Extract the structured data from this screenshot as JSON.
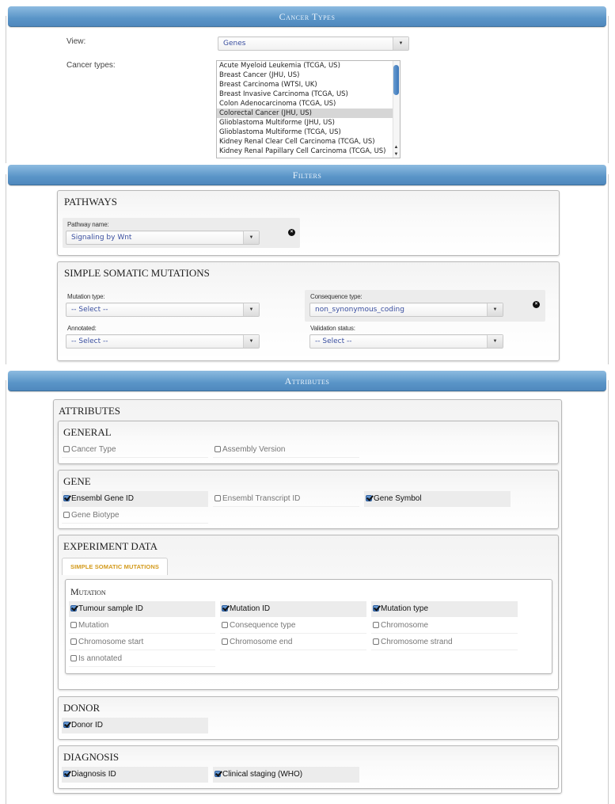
{
  "cancer_types_section": {
    "header": "Cancer Types",
    "view_label": "View:",
    "view_value": "Genes",
    "cancer_types_label": "Cancer types:",
    "cancer_types": [
      {
        "label": "Acute Myeloid Leukemia (TCGA, US)",
        "selected": false
      },
      {
        "label": "Breast Cancer (JHU, US)",
        "selected": false
      },
      {
        "label": "Breast Carcinoma (WTSI, UK)",
        "selected": false
      },
      {
        "label": "Breast Invasive Carcinoma (TCGA, US)",
        "selected": false
      },
      {
        "label": "Colon Adenocarcinoma (TCGA, US)",
        "selected": false
      },
      {
        "label": "Colorectal Cancer (JHU, US)",
        "selected": true
      },
      {
        "label": "Glioblastoma Multiforme (JHU, US)",
        "selected": false
      },
      {
        "label": "Glioblastoma Multiforme (TCGA, US)",
        "selected": false
      },
      {
        "label": "Kidney Renal Clear Cell Carcinoma (TCGA, US)",
        "selected": false
      },
      {
        "label": "Kidney Renal Papillary Cell Carcinoma (TCGA, US)",
        "selected": false
      }
    ]
  },
  "filters_section": {
    "header": "Filters",
    "pathways": {
      "title": "PATHWAYS",
      "pathway_name_label": "Pathway name:",
      "pathway_name_value": "Signaling by Wnt"
    },
    "ssm": {
      "title": "SIMPLE SOMATIC MUTATIONS",
      "mutation_type_label": "Mutation type:",
      "mutation_type_value": "-- Select --",
      "consequence_type_label": "Consequence type:",
      "consequence_type_value": "non_synonymous_coding",
      "annotated_label": "Annotated:",
      "annotated_value": "-- Select --",
      "validation_status_label": "Validation status:",
      "validation_status_value": "-- Select --"
    }
  },
  "attributes_section": {
    "header": "Attributes",
    "title": "ATTRIBUTES",
    "general": {
      "title": "GENERAL",
      "items": [
        {
          "label": "Cancer Type",
          "checked": false
        },
        {
          "label": "Assembly Version",
          "checked": false
        }
      ]
    },
    "gene": {
      "title": "GENE",
      "items": [
        {
          "label": "Ensembl Gene ID",
          "checked": true
        },
        {
          "label": "Ensembl Transcript ID",
          "checked": false
        },
        {
          "label": "Gene Symbol",
          "checked": true
        },
        {
          "label": "Gene Biotype",
          "checked": false
        }
      ]
    },
    "experiment_data": {
      "title": "EXPERIMENT DATA",
      "tab": "SIMPLE SOMATIC MUTATIONS",
      "mutation": {
        "title": "Mutation",
        "items": [
          {
            "label": "Tumour sample ID",
            "checked": true
          },
          {
            "label": "Mutation ID",
            "checked": true
          },
          {
            "label": "Mutation type",
            "checked": true
          },
          {
            "label": "Mutation",
            "checked": false
          },
          {
            "label": "Consequence type",
            "checked": false
          },
          {
            "label": "Chromosome",
            "checked": false
          },
          {
            "label": "Chromosome start",
            "checked": false
          },
          {
            "label": "Chromosome end",
            "checked": false
          },
          {
            "label": "Chromosome strand",
            "checked": false
          },
          {
            "label": "Is annotated",
            "checked": false
          }
        ]
      }
    },
    "donor": {
      "title": "DONOR",
      "items": [
        {
          "label": "Donor ID",
          "checked": true
        }
      ]
    },
    "diagnosis": {
      "title": "DIAGNOSIS",
      "items": [
        {
          "label": "Diagnosis ID",
          "checked": true
        },
        {
          "label": "Clinical staging (WHO)",
          "checked": true
        }
      ]
    }
  }
}
